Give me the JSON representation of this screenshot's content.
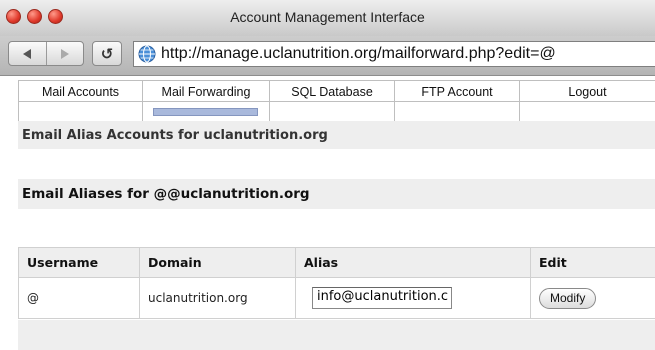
{
  "window": {
    "title": "Account Management Interface"
  },
  "toolbar": {
    "url": "http://manage.uclanutrition.org/mailforward.php?edit=@",
    "reload_glyph": "↺"
  },
  "tabs": [
    {
      "label": "Mail Accounts",
      "active": false
    },
    {
      "label": "Mail Forwarding",
      "active": true
    },
    {
      "label": "SQL Database",
      "active": false
    },
    {
      "label": "FTP Account",
      "active": false
    },
    {
      "label": "Logout",
      "active": false
    }
  ],
  "sections": {
    "accounts_heading": "Email Alias Accounts for uclanutrition.org",
    "aliases_heading": "Email Aliases for @@uclanutrition.org"
  },
  "table": {
    "headers": [
      "Username",
      "Domain",
      "Alias",
      "Edit"
    ],
    "row": {
      "username": "@",
      "domain": "uclanutrition.org",
      "alias_value": "info@uclanutrition.c",
      "edit_label": "Modify"
    }
  },
  "colors": {
    "active_tab_marker": "#a9b9dc",
    "section_bg": "#eeeeee"
  }
}
